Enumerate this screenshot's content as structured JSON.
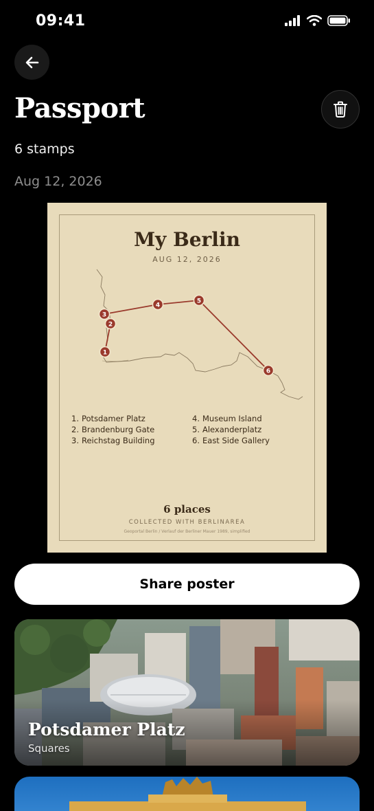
{
  "status": {
    "time": "09:41"
  },
  "header": {
    "title": "Passport",
    "stamp_count": "6 stamps",
    "date": "Aug 12, 2026"
  },
  "poster": {
    "title": "My Berlin",
    "date": "AUG 12, 2026",
    "places_left": [
      {
        "num": "1.",
        "name": "Potsdamer Platz"
      },
      {
        "num": "2.",
        "name": "Brandenburg Gate"
      },
      {
        "num": "3.",
        "name": "Reichstag Building"
      }
    ],
    "places_right": [
      {
        "num": "4.",
        "name": "Museum Island"
      },
      {
        "num": "5.",
        "name": "Alexanderplatz"
      },
      {
        "num": "6.",
        "name": "East Side Gallery"
      }
    ],
    "markers": [
      "1",
      "2",
      "3",
      "4",
      "5",
      "6"
    ],
    "count_label": "6 places",
    "collected_label": "COLLECTED WITH BERLINAREA",
    "source_label": "Geoportal Berlin / Verlauf der Berliner Mauer 1989, simplified"
  },
  "share_button": {
    "label": "Share poster"
  },
  "cards": [
    {
      "title": "Potsdamer Platz",
      "category": "Squares"
    }
  ],
  "colors": {
    "background": "#000000",
    "poster_bg": "#e8dbbb",
    "route": "#9a3a2c",
    "ink": "#3a2a18"
  },
  "icons": [
    "back-arrow-icon",
    "trash-icon",
    "signal-icon",
    "wifi-icon",
    "battery-icon"
  ]
}
